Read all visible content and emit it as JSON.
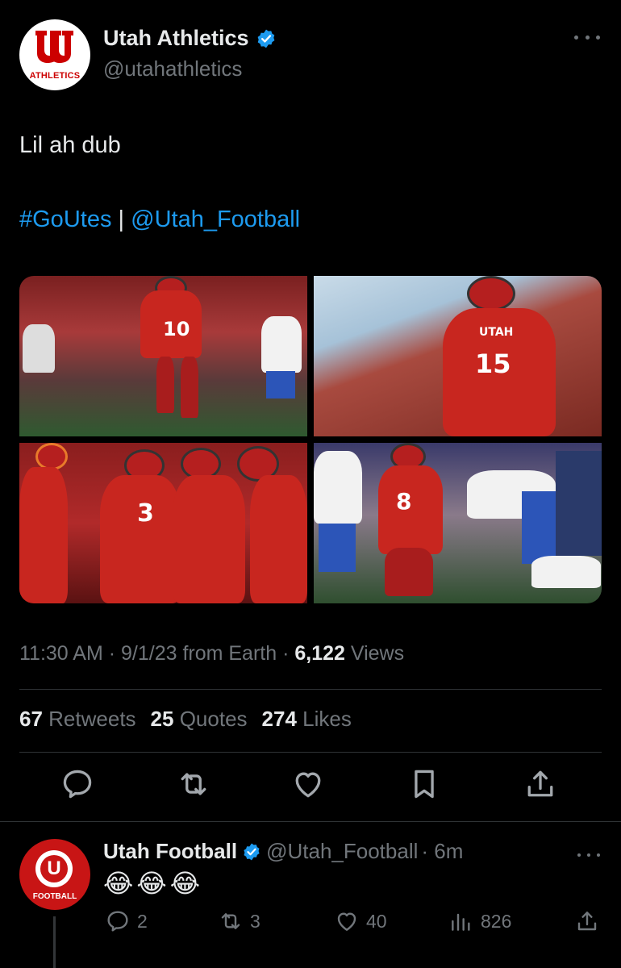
{
  "tweet": {
    "display_name": "Utah Athletics",
    "handle": "@utahathletics",
    "avatar_label": "ATHLETICS",
    "text": "Lil ah dub",
    "hashtag": "#GoUtes",
    "separator": "|",
    "mention": "@Utah_Football",
    "meta_time": "11:30 AM · 9/1/23 from Earth · ",
    "views_count": "6,122",
    "views_label": " Views",
    "retweets_count": "67",
    "retweets_label": "Retweets",
    "quotes_count": "25",
    "quotes_label": "Quotes",
    "likes_count": "274",
    "likes_label": "Likes",
    "photo_numbers": [
      "10",
      "15",
      "3",
      "8"
    ],
    "photo_text": "UTAH"
  },
  "reply": {
    "display_name": "Utah Football",
    "handle": "@Utah_Football",
    "time": "· 6m",
    "text": "😂😂😂",
    "avatar_label": "FOOTBALL",
    "avatar_letter": "U",
    "replies": "2",
    "retweets": "3",
    "likes": "40",
    "views": "826"
  },
  "colors": {
    "accent": "#1d9bf0",
    "muted": "#71767b",
    "text": "#e7e9ea",
    "background": "#000000",
    "utah_red": "#cc0000"
  },
  "icons": [
    "verified-badge-icon",
    "more-icon",
    "reply-icon",
    "retweet-icon",
    "like-icon",
    "bookmark-icon",
    "share-icon",
    "views-icon"
  ]
}
